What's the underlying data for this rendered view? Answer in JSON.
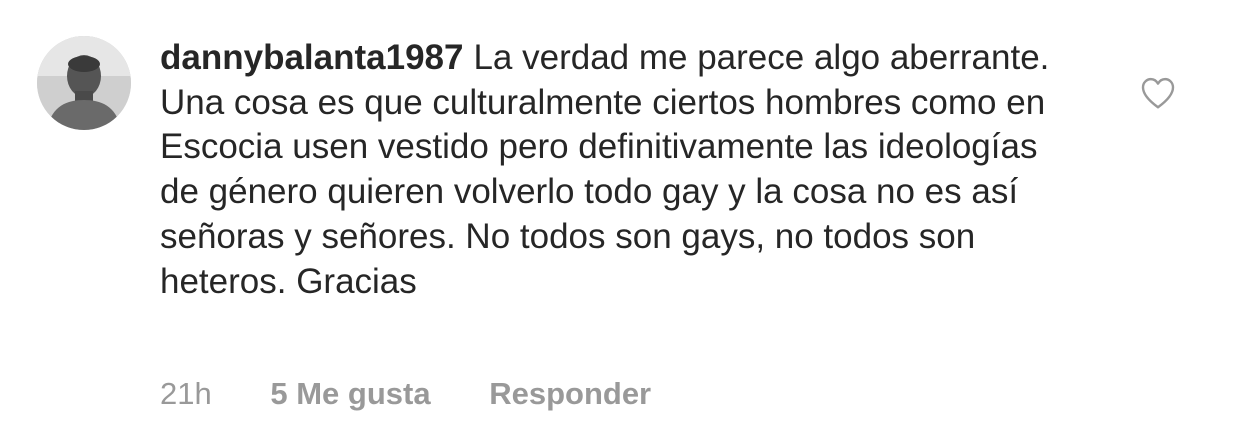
{
  "comment": {
    "username": "dannybalanta1987",
    "text": "La verdad me parece algo aberrante. Una cosa es que culturalmente ciertos hombres como en Escocia usen vestido pero definitivamente las ideologías de género quieren volverlo todo gay y la cosa no es así señoras y señores. No todos son gays, no todos son heteros. Gracias",
    "time": "21h",
    "likes_label": "5 Me gusta",
    "reply_label": "Responder",
    "avatar_icon": "user-avatar-photo",
    "like_icon": "heart-outline-icon"
  },
  "colors": {
    "text": "#262626",
    "meta": "#999999",
    "icon": "#999999"
  }
}
